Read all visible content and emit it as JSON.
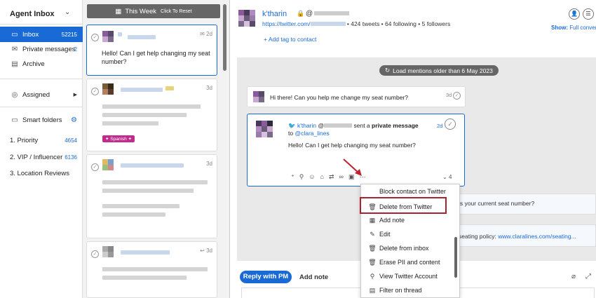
{
  "sidebar": {
    "title": "Agent Inbox",
    "items": [
      {
        "label": "Inbox",
        "count": "52215",
        "icon": "inbox-icon"
      },
      {
        "label": "Private messages",
        "count": "2",
        "icon": "mail-icon"
      },
      {
        "label": "Archive",
        "count": "",
        "icon": "archive-icon"
      }
    ],
    "assigned": "Assigned",
    "smart_folders": "Smart folders",
    "folders": [
      {
        "label": "1. Priority",
        "count": "4654"
      },
      {
        "label": "2. VIP / Influencer",
        "count": "6136"
      },
      {
        "label": "3. Location Reviews",
        "count": ""
      }
    ]
  },
  "list": {
    "week_label": "This Week",
    "reset_label": "Click To Reset",
    "cards": [
      {
        "age": "2d",
        "text_line1": "Hello! Can I get help changing my seat",
        "text_line2": "number?"
      },
      {
        "age": "3d",
        "tag": "Spanish"
      },
      {
        "age": "3d"
      },
      {
        "age": "3d"
      }
    ]
  },
  "profile": {
    "name": "k'tharin",
    "handle": "@",
    "url": "https://twitter.com/",
    "stats": "• 424 tweets • 64 following • 5 followers",
    "add_tag": "+ Add tag to contact",
    "show_label": "Show:",
    "show_value": "Full conver"
  },
  "conversation": {
    "load_mentions": "Load mentions older than 6 May 2023",
    "msg1": {
      "text": "Hi there! Can you help me change my seat number?",
      "age": "3d"
    },
    "msg2": {
      "author": "k'tharin",
      "handle": "@",
      "sent_text": "sent a",
      "sent_bold": "private message",
      "to_label": "to",
      "to_handle": "@clara_lines",
      "age": "2d",
      "text": "Hello! Can I get help changing my seat number?",
      "count": "4"
    },
    "side1_text": "is your current seat number?",
    "side2_text": "seating policy: ",
    "side2_link": "www.claralines.com/seating..."
  },
  "menu": {
    "items": [
      {
        "label": "Block contact on Twitter",
        "icon": ""
      },
      {
        "label": "Delete from Twitter",
        "icon": "trash-icon"
      },
      {
        "label": "Add note",
        "icon": "note-icon"
      },
      {
        "label": "Edit",
        "icon": "edit-icon"
      },
      {
        "label": "Delete from inbox",
        "icon": "trash-icon"
      },
      {
        "label": "Erase PII and content",
        "icon": "trash-icon"
      },
      {
        "label": "View Twitter Account",
        "icon": "user-icon"
      },
      {
        "label": "Filter on thread",
        "icon": "filter-icon"
      }
    ]
  },
  "reply": {
    "reply_pm": "Reply with PM",
    "add_note": "Add note"
  },
  "colors": {
    "accent": "#1a6ad6",
    "highlight": "#a8232f",
    "tag": "#c02c8c"
  }
}
